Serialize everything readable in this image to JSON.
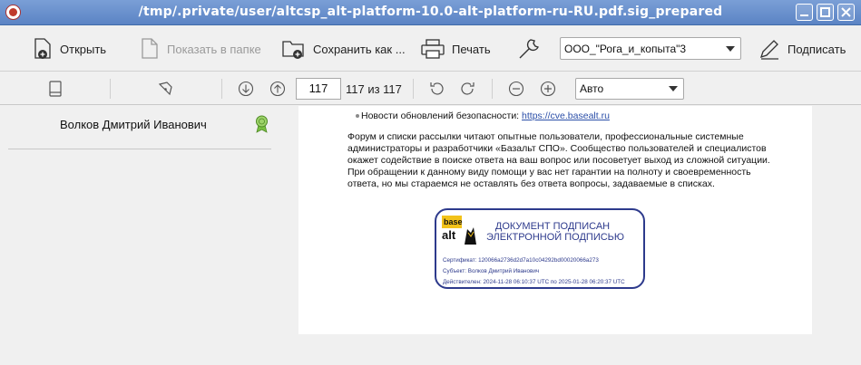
{
  "window": {
    "title": "/tmp/.private/user/altcsp_alt-platform-10.0-alt-platform-ru-RU.pdf.sig_prepared"
  },
  "toolbar": {
    "open_label": "Открыть",
    "show_in_folder_label": "Показать в папке",
    "save_as_label": "Сохранить как ...",
    "print_label": "Печать",
    "certificate_selected": "ООО_\"Рога_и_копыта\"3",
    "sign_label": "Подписать"
  },
  "navbar": {
    "current_page": "117",
    "page_total_text": "117 из 117",
    "zoom_selected": "Авто"
  },
  "signatures": {
    "signer_name": "Волков Дмитрий Иванович",
    "status_color": "#7ac142"
  },
  "document": {
    "news_label": "Новости обновлений безопасности: ",
    "news_link": "https://cve.basealt.ru",
    "paragraph": "Форум и списки рассылки читают опытные пользователи, профессиональные системные администраторы и разработчики «Базальт СПО». Сообщество пользователей и специалистов окажет содействие в поиске ответа на ваш вопрос или посоветует выход из сложной ситуации. При обращении к данному виду помощи у вас нет гарантии на полноту и своевременность ответа, но мы стараемся не оставлять без ответа вопросы, задаваемые в списках.",
    "stamp": {
      "logo_top": "base",
      "logo_bottom": "alt",
      "line1": "ДОКУМЕНТ ПОДПИСАН",
      "line2": "ЭЛЕКТРОННОЙ ПОДПИСЬЮ",
      "certificate": "Сертификат: 120066a2736d2d7a10c04292bd00020066a273",
      "subject": "Субъект: Волков Дмитрий Иванович",
      "validity": "Действителен: 2024-11-28 06:10:37 UTC по 2025-01-28 06:20:37 UTC",
      "color": "#2d3a8c"
    }
  }
}
